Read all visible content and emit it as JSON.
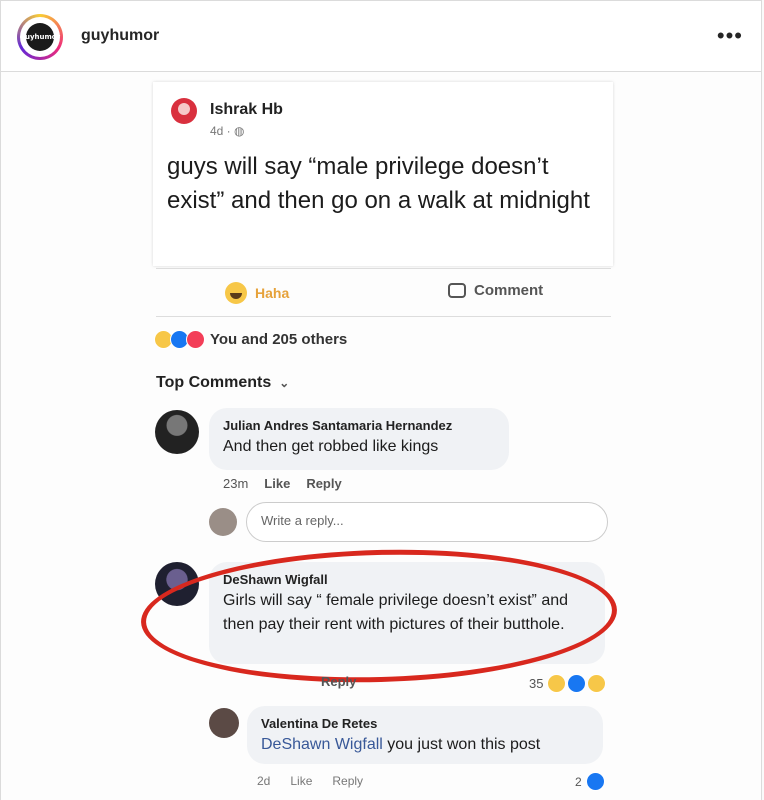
{
  "header": {
    "account": "guyhumor",
    "logo_text": "guyhumor",
    "more_icon": "more-dots-icon"
  },
  "post": {
    "author": "Ishrak Hb",
    "time": "4d · ",
    "text": "guys will say “male privilege doesn’t exist” and then go on a walk at midnight"
  },
  "actions": {
    "haha": "Haha",
    "comment": "Comment"
  },
  "reactions": {
    "summary": "You and 205 others"
  },
  "top_comments": {
    "label": "Top Comments",
    "chevron": "⌄"
  },
  "comments": [
    {
      "name": "Julian Andres Santamaria Hernandez",
      "text": "And then get robbed like kings",
      "time": "23m",
      "like": "Like",
      "reply": "Reply"
    },
    {
      "name": "DeShawn Wigfall",
      "text": "Girls will say “ female privilege doesn’t exist” and then pay their rent with pictures of their butthole.",
      "reply": "Reply",
      "count": "35"
    },
    {
      "name": "Valentina De Retes",
      "mention": "DeShawn Wigfall",
      "text": " you just won this post",
      "time": "2d",
      "like": "Like",
      "reply": "Reply",
      "count": "2"
    }
  ],
  "reply_input": {
    "placeholder": "Write a reply..."
  }
}
